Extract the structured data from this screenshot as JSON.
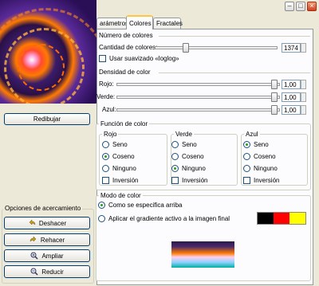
{
  "tabs": [
    "arámetros",
    "Colores",
    "Fractales"
  ],
  "window_buttons": [
    "–",
    "□",
    "×"
  ],
  "left": {
    "redraw": "Redibujar",
    "zoom_group": "Opciones de acercamiento",
    "undo": "Deshacer",
    "redo": "Rehacer",
    "zoom_in": "Ampliar",
    "zoom_out": "Reducir"
  },
  "num_colors": {
    "title": "Número de colores",
    "quantity_label": "Cantidad de colores:",
    "quantity_value": "1374",
    "smooth_label": "Usar suavizado «loglog»",
    "slider_fraction": 0.24
  },
  "density": {
    "title": "Densidad de color",
    "rows": [
      {
        "label": "Rojo:",
        "value": "1,00"
      },
      {
        "label": "Verde:",
        "value": "1,00"
      },
      {
        "label": "Azul:",
        "value": "1,00"
      }
    ]
  },
  "color_function": {
    "title": "Función de color",
    "groups": [
      {
        "title": "Rojo",
        "options": [
          "Seno",
          "Coseno",
          "Ninguno"
        ],
        "selected": 1,
        "invert": "Inversión"
      },
      {
        "title": "Verde",
        "options": [
          "Seno",
          "Coseno",
          "Ninguno"
        ],
        "selected": 2,
        "invert": "Inversión"
      },
      {
        "title": "Azul",
        "options": [
          "Seno",
          "Coseno",
          "Ninguno"
        ],
        "selected": 0,
        "invert": "Inversión"
      }
    ]
  },
  "color_mode": {
    "title": "Modo de color",
    "option1": "Como se especifica arriba",
    "option2": "Aplicar el gradiente activo a la imagen final",
    "gradient_colors": [
      "#000000",
      "#ff0000",
      "#ffff00"
    ]
  }
}
